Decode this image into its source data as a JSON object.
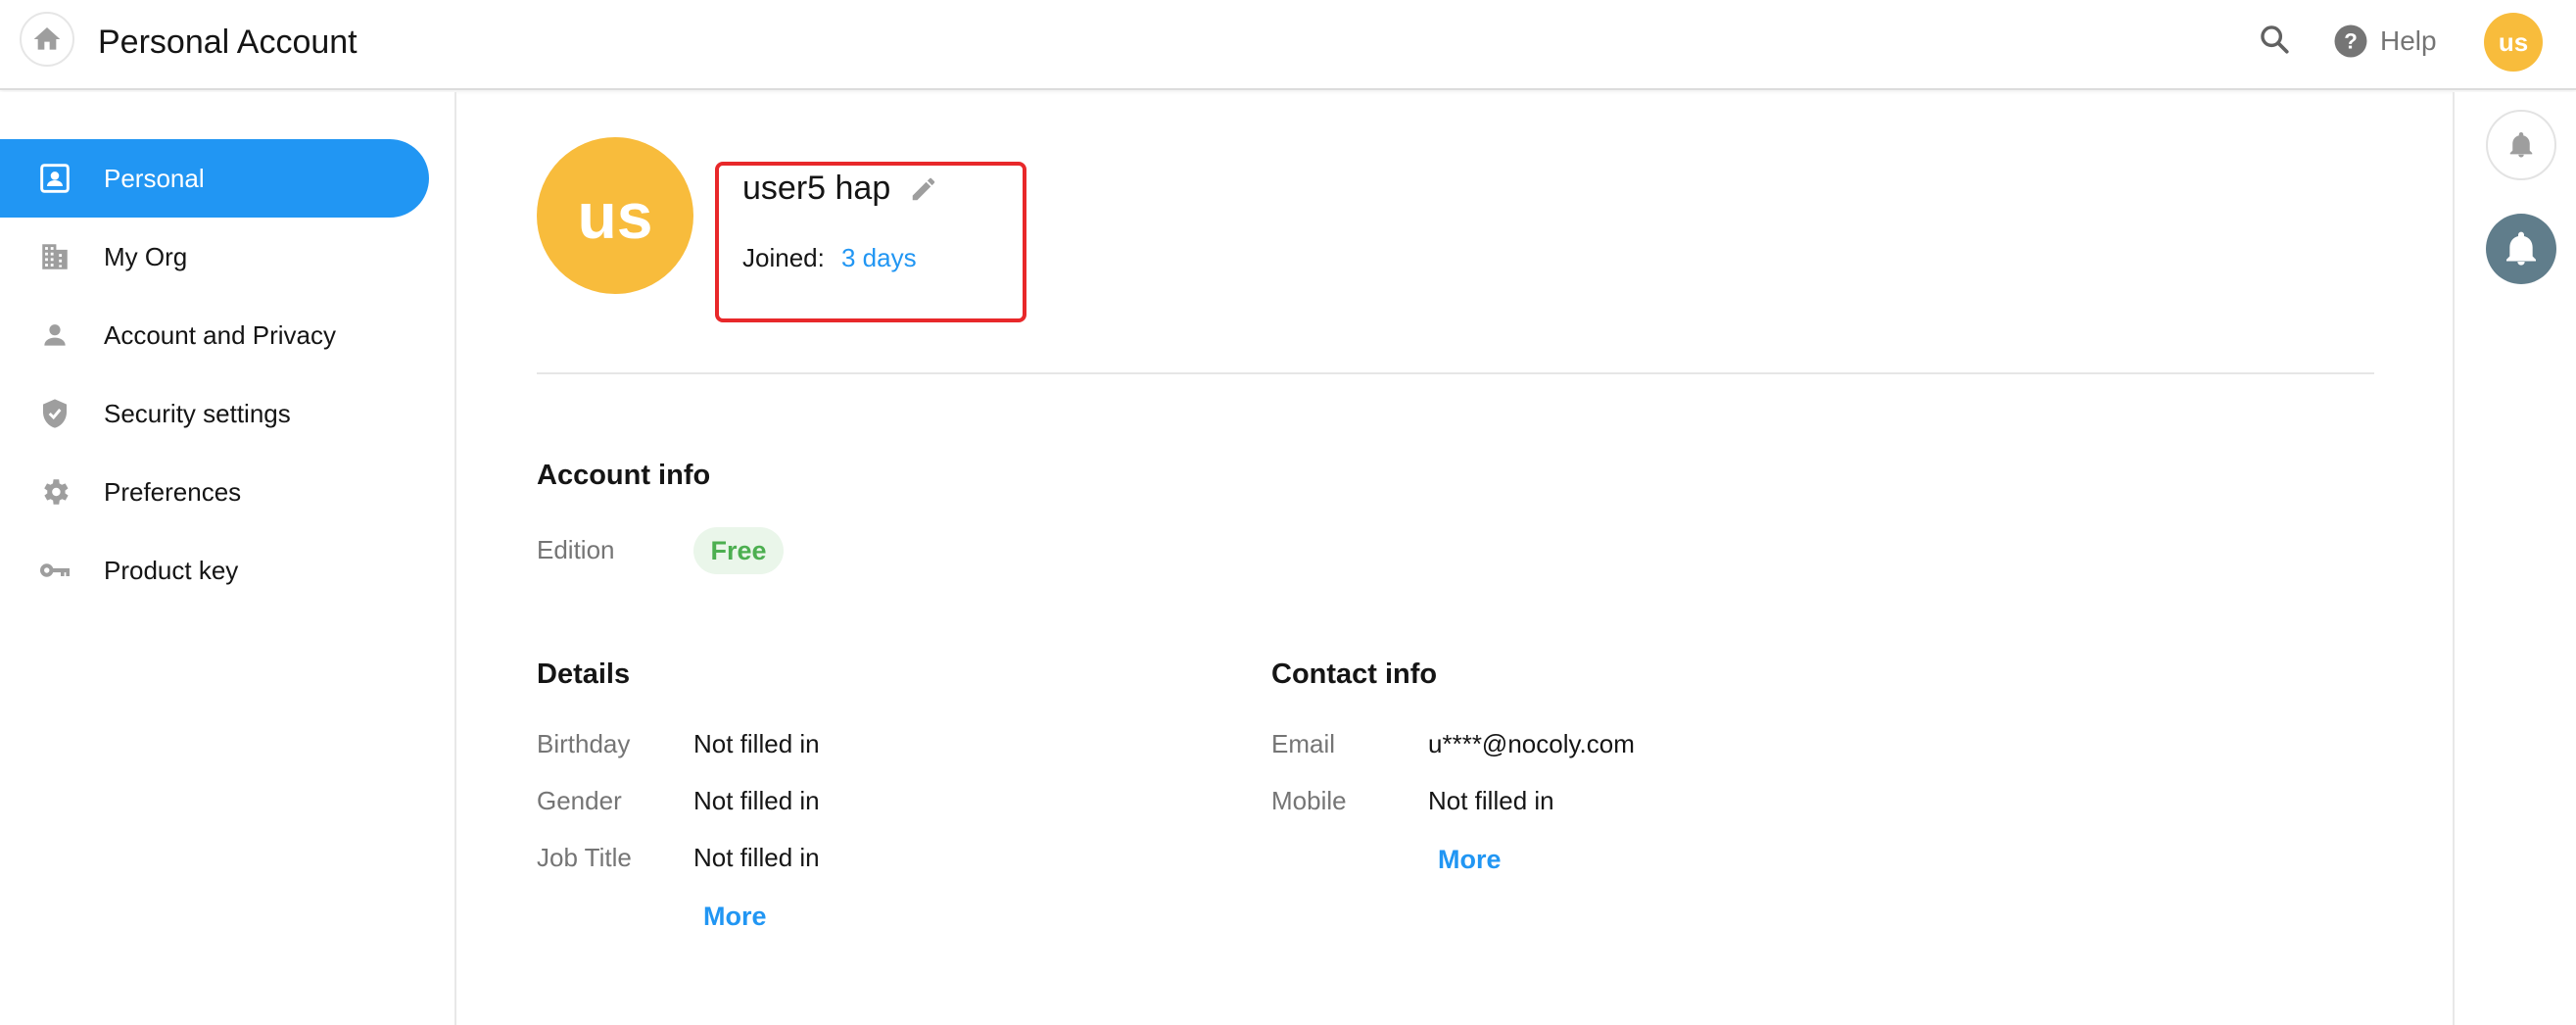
{
  "header": {
    "title": "Personal Account",
    "help_label": "Help",
    "avatar_initials": "us"
  },
  "sidebar": {
    "items": [
      {
        "label": "Personal",
        "icon": "contact-card-icon",
        "active": true
      },
      {
        "label": "My Org",
        "icon": "building-icon",
        "active": false
      },
      {
        "label": "Account and Privacy",
        "icon": "person-icon",
        "active": false
      },
      {
        "label": "Security settings",
        "icon": "shield-icon",
        "active": false
      },
      {
        "label": "Preferences",
        "icon": "gear-icon",
        "active": false
      },
      {
        "label": "Product key",
        "icon": "key-icon",
        "active": false
      }
    ]
  },
  "profile": {
    "avatar_initials": "us",
    "name": "user5 hap",
    "joined_label": "Joined:",
    "joined_value": "3 days"
  },
  "account_info": {
    "title": "Account info",
    "edition_label": "Edition",
    "edition_value": "Free"
  },
  "details": {
    "title": "Details",
    "fields": [
      {
        "label": "Birthday",
        "value": "Not filled in"
      },
      {
        "label": "Gender",
        "value": "Not filled in"
      },
      {
        "label": "Job Title",
        "value": "Not filled in"
      }
    ],
    "more_label": "More"
  },
  "contact": {
    "title": "Contact info",
    "fields": [
      {
        "label": "Email",
        "value": "u****@nocoly.com"
      },
      {
        "label": "Mobile",
        "value": "Not filled in"
      }
    ],
    "more_label": "More"
  },
  "colors": {
    "accent": "#2196f3",
    "avatar": "#f8bc3c",
    "highlight": "#e8282a",
    "free_badge_text": "#4caf50"
  }
}
